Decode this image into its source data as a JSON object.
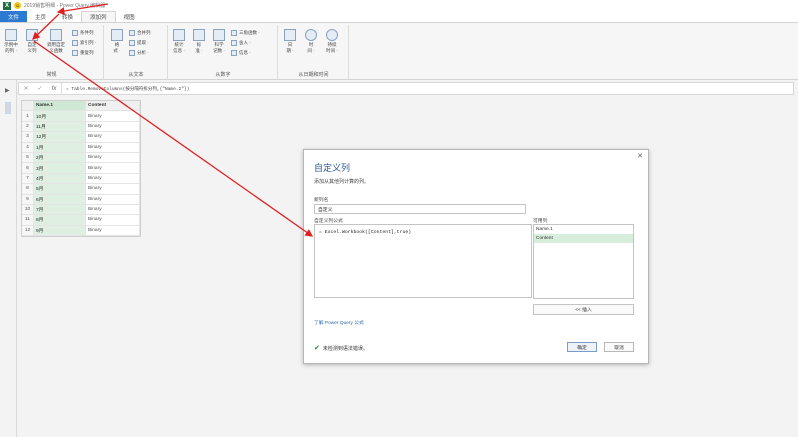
{
  "window": {
    "excel_badge": "X",
    "smiley": "☺",
    "title": "2019销售明细 - Power Query 编辑器"
  },
  "tabs": [
    "文件",
    "主页",
    "转换",
    "添加列",
    "视图"
  ],
  "ribbon": {
    "groups": {
      "general": "常规",
      "from_text": "从文本",
      "from_number": "从数字",
      "from_datetime": "从日期和时间"
    },
    "buttons": {
      "example_column": "示例中\n的列 ·",
      "custom_column": "自定\n义列",
      "invoke_custom_function": "调用自定\n义函数",
      "conditional_column": "条件列",
      "index_column": "索引列 ·",
      "duplicate_column": "重复列",
      "format": "格\n式 ·",
      "merge_columns": "合并列",
      "extract": "提取 ·",
      "parse": "分析 ·",
      "statistics": "统计\n信息 ·",
      "standard": "标\n准 ·",
      "scientific": "科学\n记数 ·",
      "trigonometry": "三角函数 ·",
      "rounding": "舍入 ·",
      "information": "信息 ·",
      "date": "日\n期 ·",
      "time": "时\n间 ·",
      "duration": "持续\n时间 ·"
    }
  },
  "formula_bar": {
    "cancel": "✕",
    "confirm": "✓",
    "fx": "fx",
    "text": "= Table.RemoveColumns(按分隔符拆分列,{\"Name.2\"})"
  },
  "grid": {
    "headers": [
      "",
      "Name.1",
      "Content"
    ],
    "rows": [
      [
        "1",
        "10月",
        "Binary"
      ],
      [
        "2",
        "11月",
        "Binary"
      ],
      [
        "3",
        "12月",
        "Binary"
      ],
      [
        "4",
        "1月",
        "Binary"
      ],
      [
        "5",
        "2月",
        "Binary"
      ],
      [
        "6",
        "3月",
        "Binary"
      ],
      [
        "7",
        "4月",
        "Binary"
      ],
      [
        "8",
        "5月",
        "Binary"
      ],
      [
        "9",
        "6月",
        "Binary"
      ],
      [
        "10",
        "7月",
        "Binary"
      ],
      [
        "11",
        "8月",
        "Binary"
      ],
      [
        "12",
        "9月",
        "Binary"
      ]
    ]
  },
  "dialog": {
    "title": "自定义列",
    "subtitle": "添加从其他列计算的列。",
    "close": "✕",
    "new_column_label": "新列名",
    "new_column_value": "自定义",
    "formula_label": "自定义列公式",
    "formula_value": "= Excel.Workbook([Content],true)",
    "available_label": "可用列",
    "available_columns": [
      "Name.1",
      "Content"
    ],
    "selected_column": "Content",
    "insert_button": "<< 插入",
    "learn_link": "了解 Power Query 公式",
    "status": "未检测到语法错误。",
    "ok_button": "确定",
    "cancel_button": "取消"
  },
  "colors": {
    "file_tab": "#2b79d0",
    "dialog_title": "#2b5797",
    "annotation_arrow": "#e02020",
    "selected_row": "#d7eedd",
    "success": "#2e8b3a"
  }
}
